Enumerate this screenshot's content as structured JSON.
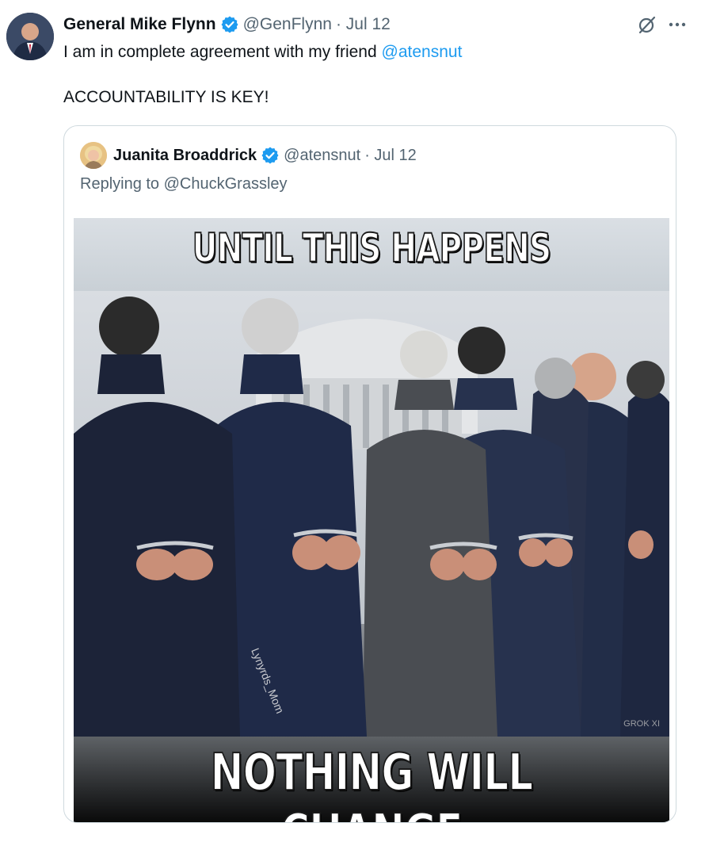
{
  "tweet": {
    "author": {
      "display_name": "General Mike Flynn",
      "handle": "@GenFlynn",
      "date": "· Jul 12"
    },
    "text_line1_prefix": "I am in complete agreement with my friend ",
    "text_line1_mention": "@atensnut",
    "text_line2": "ACCOUNTABILITY IS KEY!",
    "icons": {
      "grok": "grok-icon",
      "more": "more-options-icon"
    }
  },
  "quote": {
    "author": {
      "display_name": "Juanita Broaddrick",
      "handle": "@atensnut",
      "date": "· Jul 12"
    },
    "replying_prefix": "Replying to ",
    "replying_to": "@ChuckGrassley",
    "image": {
      "top_caption": "UNTIL THIS HAPPENS",
      "bottom_caption": "NOTHING WILL CHANGE",
      "watermark": "Lynyrds_Mom",
      "grok_mark": "GROK XI"
    }
  },
  "colors": {
    "link": "#1d9bf0",
    "verified": "#1d9bf0",
    "muted": "#536471",
    "border": "#cfd9de"
  }
}
